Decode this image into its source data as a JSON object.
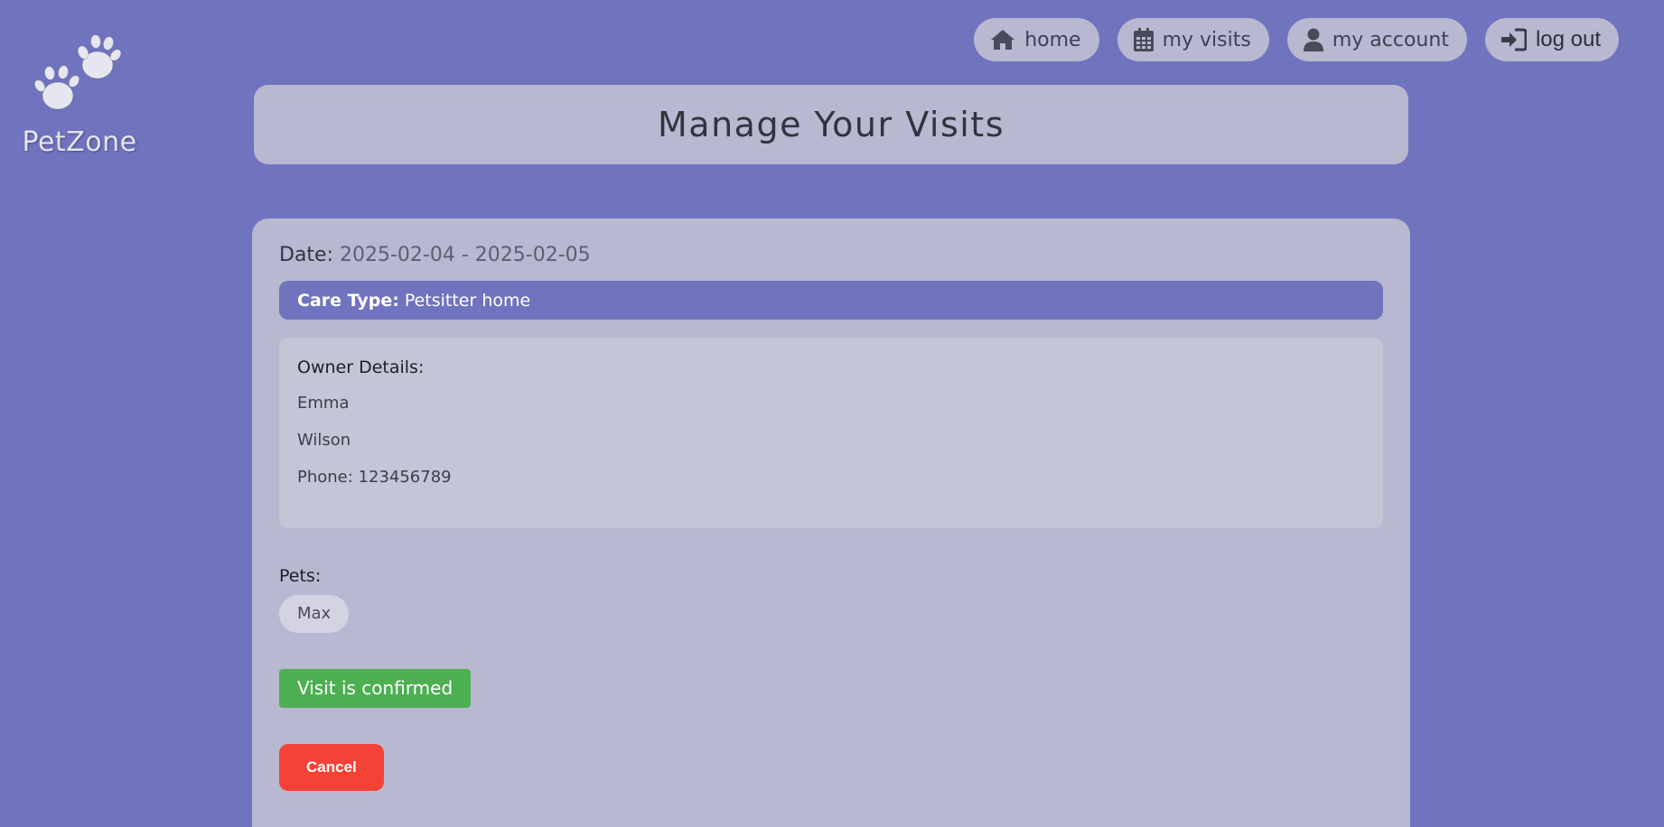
{
  "brand": {
    "logo_icon": "paw-prints-icon",
    "name": "PetZone"
  },
  "nav": {
    "items": [
      {
        "label": "home",
        "icon": "home-icon"
      },
      {
        "label": "my visits",
        "icon": "calendar-icon"
      },
      {
        "label": "my account",
        "icon": "user-icon"
      },
      {
        "label": "log out",
        "icon": "sign-in-icon"
      }
    ]
  },
  "page": {
    "title": "Manage Your Visits"
  },
  "visit": {
    "date_label": "Date:",
    "date_value": "2025-02-04 - 2025-02-05",
    "care_type_label": "Care Type:",
    "care_type_value": "Petsitter home",
    "owner": {
      "heading": "Owner Details:",
      "first_name": "Emma",
      "last_name": "Wilson",
      "phone": "Phone: 123456789"
    },
    "pets_label": "Pets:",
    "pets": [
      "Max"
    ],
    "status": "Visit is confirmed",
    "cancel_label": "Cancel"
  },
  "colors": {
    "background": "#7073bd",
    "card": "#b8b8d1",
    "accent": "#7073bd",
    "confirmed": "#4caf50",
    "cancel": "#f44336"
  }
}
